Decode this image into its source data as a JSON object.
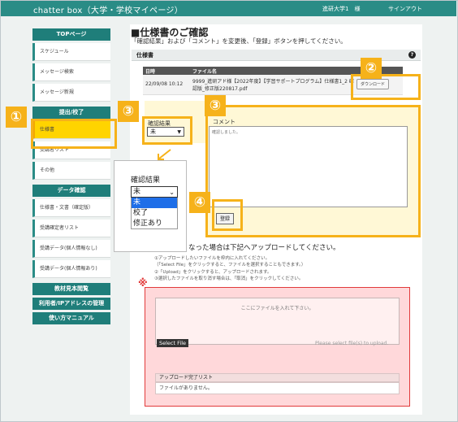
{
  "header": {
    "app_title": "chatter box（大学・学校マイページ）",
    "user": "進研大学1　様",
    "signout": "サインアウト"
  },
  "sidebar": {
    "top_section": "TOPページ",
    "top_items": [
      {
        "label": "スケジュール"
      },
      {
        "label": "メッセージ検索"
      },
      {
        "label": "メッセージ新規"
      }
    ],
    "submit_section": "提出/校了",
    "submit_items": [
      {
        "label": "仕様書"
      },
      {
        "label": "受講者リスト"
      },
      {
        "label": "その他"
      }
    ],
    "data_section": "データ確認",
    "data_items": [
      {
        "label": "仕様書・文書（確定版）"
      },
      {
        "label": "受講確定者リスト"
      },
      {
        "label": "受講データ(個人情報なし)"
      },
      {
        "label": "受講データ(個人情報あり)"
      }
    ],
    "bottom_items": [
      {
        "label": "教材見本閲覧"
      },
      {
        "label": "利用者/IPアドレスの管理"
      },
      {
        "label": "使い方マニュアル"
      }
    ]
  },
  "main": {
    "title": "■仕様書のご確認",
    "lead": "「確認結果」および「コメント」を変更後、「登録」ボタンを押してください。",
    "panel_title": "仕様書",
    "help_icon": "?",
    "table_headers": [
      "日時",
      "ファイル名",
      ""
    ],
    "table_row": {
      "datetime": "22/09/08 10:12",
      "filename": "9999_進研アド様【2022年度】【学習サポートプログラム】仕様書1_2 確認版_修正版220817.pdf",
      "download": "ダウンロード"
    },
    "confirm_label": "確認結果",
    "confirm_value": "未",
    "comment_label": "コメント",
    "comment_value": "確認しました。",
    "register_button": "登録"
  },
  "popup": {
    "label": "確認結果",
    "selected": "未",
    "options": [
      "未",
      "校了",
      "修正あり"
    ]
  },
  "upload": {
    "lead": "なった場合は下記へアップロードしてください。",
    "notes": [
      "①アップロードしたいファイルを枠内に入れてください。",
      "（「Select File」をクリックすると、ファイルを選択することもできます。）",
      "②「Upload」をクリックすると、アップロードされます。",
      "③選択したファイルを取り消す場合は、「取消」をクリックしてください。"
    ],
    "drop_text": "ここにファイルを入れて下さい。",
    "select_file": "Select File",
    "please": "Please select file(s) to upload.",
    "done_head": "アップロード完了リスト",
    "done_body": "ファイルがありません。"
  },
  "annotations": {
    "b1": "①",
    "b2": "②",
    "b3a": "③",
    "b3b": "③",
    "b4": "④",
    "note": "※"
  },
  "colors": {
    "teal": "#2a8c86",
    "highlight": "#f6b21a",
    "select_blue": "#1e6ee8",
    "alert_red": "#e23b3b"
  }
}
